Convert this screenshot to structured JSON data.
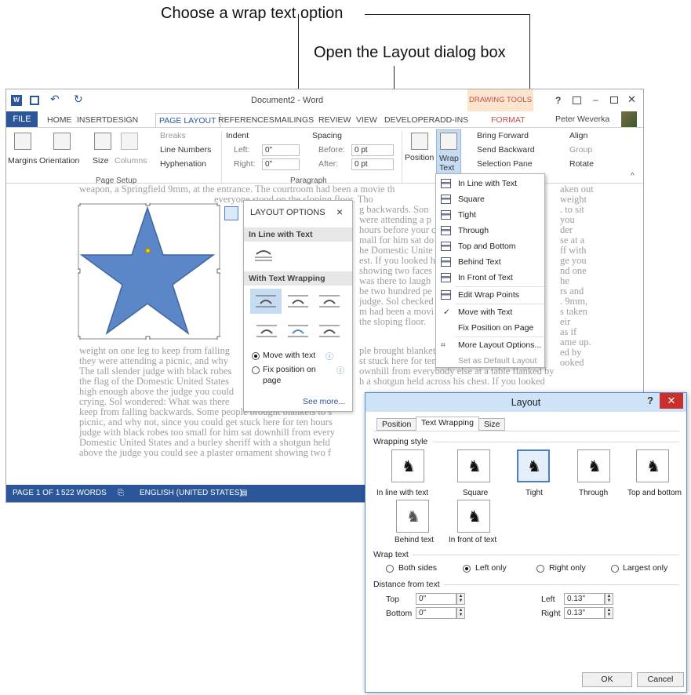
{
  "callouts": {
    "wrap_option": "Choose a wrap text option",
    "layout_dialog": "Open the Layout dialog box"
  },
  "window": {
    "title": "Document2 - Word",
    "context_group": "DRAWING TOOLS",
    "help": "?",
    "user": "Peter Weverka"
  },
  "tabs": [
    "FILE",
    "HOME",
    "INSERT",
    "DESIGN",
    "PAGE LAYOUT",
    "REFERENCES",
    "MAILINGS",
    "REVIEW",
    "VIEW",
    "DEVELOPER",
    "ADD-INS",
    "FORMAT"
  ],
  "ribbon": {
    "margins": "Margins",
    "orientation": "Orientation",
    "size": "Size",
    "columns": "Columns",
    "breaks": "Breaks",
    "line_numbers": "Line Numbers",
    "hyphenation": "Hyphenation",
    "page_setup": "Page Setup",
    "indent": "Indent",
    "spacing": "Spacing",
    "left": "Left:",
    "right": "Right:",
    "before": "Before:",
    "after": "After:",
    "indent_left_val": "0\"",
    "indent_right_val": "0\"",
    "before_val": "0 pt",
    "after_val": "0 pt",
    "paragraph": "Paragraph",
    "position": "Position",
    "wrap_text": "Wrap",
    "wrap_text2": "Text",
    "bring_forward": "Bring Forward",
    "send_backward": "Send Backward",
    "selection_pane": "Selection Pane",
    "align": "Align",
    "group": "Group",
    "rotate": "Rotate"
  },
  "doc_lines": [
    "weapon, a Springfield 9mm, at the entrance. The courtroom had been a movie th",
    "weight on one leg to keep from falling",
    "they were attending a picnic, and why",
    "The tall slender judge with black robes",
    "the flag of the Domestic United States",
    "high enough above the judge you could",
    "crying. Sol wondered: What was there",
    "keep from falling backwards. Some people brought blankets to s",
    "picnic, and why not, since you could get stuck here for ten hours",
    "judge with black robes too small for him sat downhill from every",
    "Domestic United States and a burley sheriff with a shotgun held",
    "above the judge you could see a plaster ornament showing two f"
  ],
  "doc_right_lines": [
    "aken out",
    "weight",
    ". to sit",
    "you",
    "der",
    "se at a",
    "ff with",
    "ge you",
    "nd one",
    "he",
    "rs and",
    ". 9mm,",
    "s taken",
    "eir",
    "as if",
    "ame up.",
    "ed by",
    "ooked"
  ],
  "doc_frag_lines": [
    "everyone stood on the sloping floor. Tho",
    "g backwards. Son",
    "were attending a p",
    "hours before your c",
    "mall for him sat do",
    "he Domestic Unite",
    "est. If you looked h",
    "showing two faces",
    "was there to laugh",
    "be two hundred pe",
    "judge. Sol checked",
    "m had been a movi",
    "the sloping floor.",
    "ple brought blanket",
    "st stuck here for ten",
    "ownhill from everybody else at a table flanked by",
    "h a shotgun held across his chest. If you looked"
  ],
  "status": {
    "page": "PAGE 1 OF 1",
    "words": "522 WORDS",
    "language": "ENGLISH (UNITED STATES)"
  },
  "layout_options": {
    "title": "LAYOUT OPTIONS",
    "close": "×",
    "inline_header": "In Line with Text",
    "wrapping_header": "With Text Wrapping",
    "move_with_text": "Move with text",
    "fix_position": "Fix position on",
    "fix_position2": "page",
    "see_more": "See more..."
  },
  "wrap_menu": {
    "items": [
      "In Line with Text",
      "Square",
      "Tight",
      "Through",
      "Top and Bottom",
      "Behind Text",
      "In Front of Text",
      "Edit Wrap Points",
      "Move with Text",
      "Fix Position on Page",
      "More Layout Options...",
      "Set as Default Layout"
    ]
  },
  "layout_dialog": {
    "title": "Layout",
    "help": "?",
    "close": "✕",
    "tabs": [
      "Position",
      "Text Wrapping",
      "Size"
    ],
    "wrapping_style": "Wrapping style",
    "styles": [
      "In line with text",
      "Square",
      "Tight",
      "Through",
      "Top and bottom",
      "Behind text",
      "In front of text"
    ],
    "wrap_text": "Wrap text",
    "wrap_options": [
      "Both sides",
      "Left only",
      "Right only",
      "Largest only"
    ],
    "distance": "Distance from text",
    "top": "Top",
    "bottom": "Bottom",
    "left": "Left",
    "right": "Right",
    "top_val": "0\"",
    "bottom_val": "0\"",
    "left_val": "0.13\"",
    "right_val": "0.13\"",
    "ok": "OK",
    "cancel": "Cancel"
  }
}
